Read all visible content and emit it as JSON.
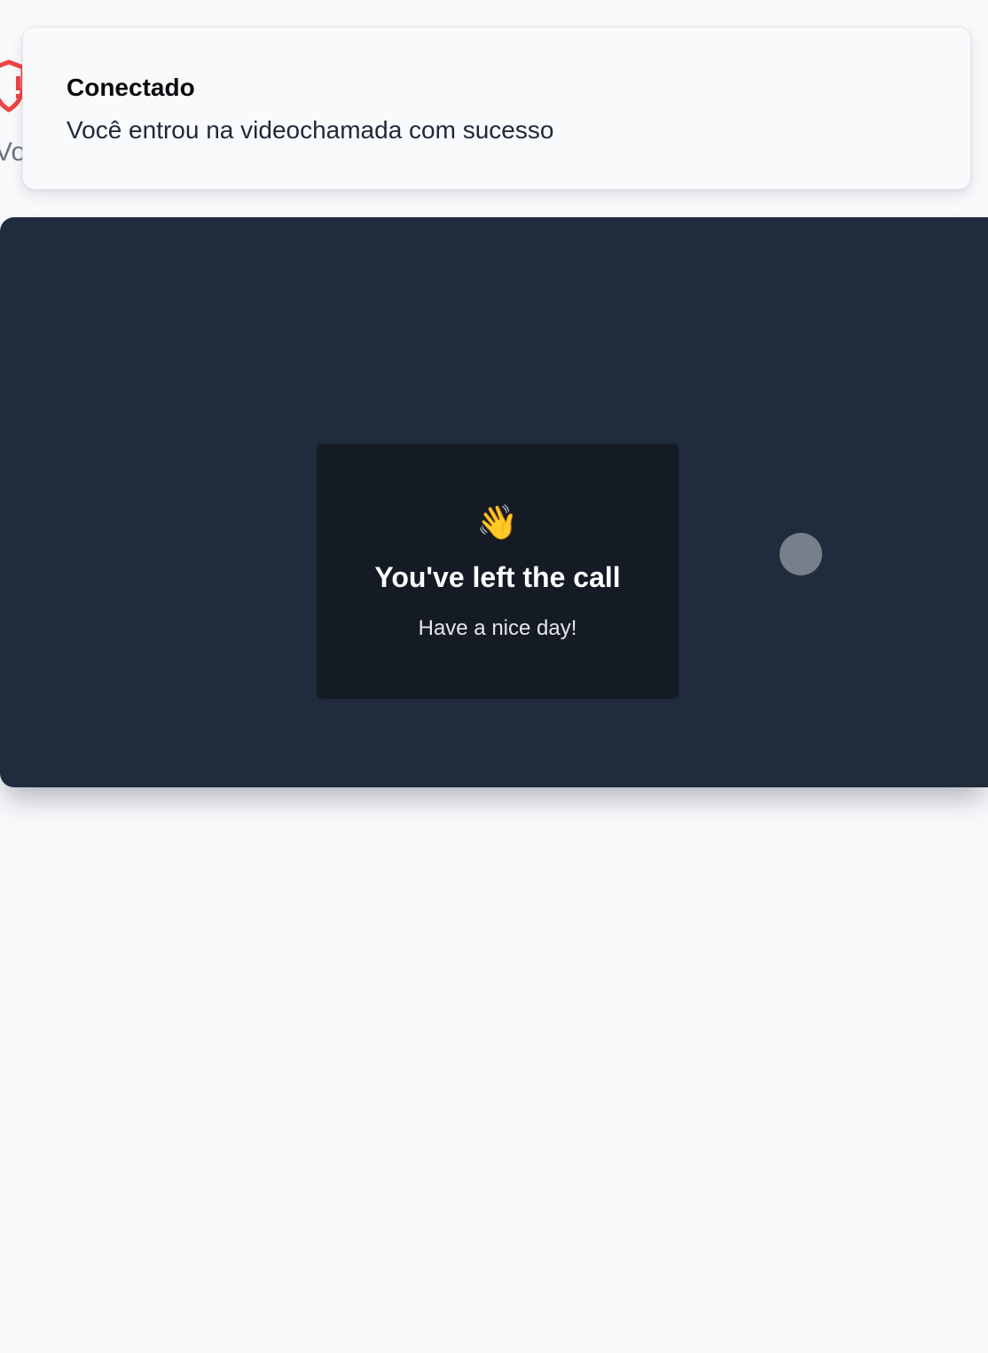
{
  "background": {
    "partial_text": "Vo",
    "shield_color": "#ef4444"
  },
  "toast": {
    "title": "Conectado",
    "description": "Você entrou na videochamada com sucesso"
  },
  "call": {
    "emoji": "👋",
    "left_title": "You've left the call",
    "left_subtitle": "Have a nice day!",
    "colors": {
      "stage": "#202c3d",
      "card": "#141b25",
      "loading_dot": "#767f8a"
    }
  }
}
